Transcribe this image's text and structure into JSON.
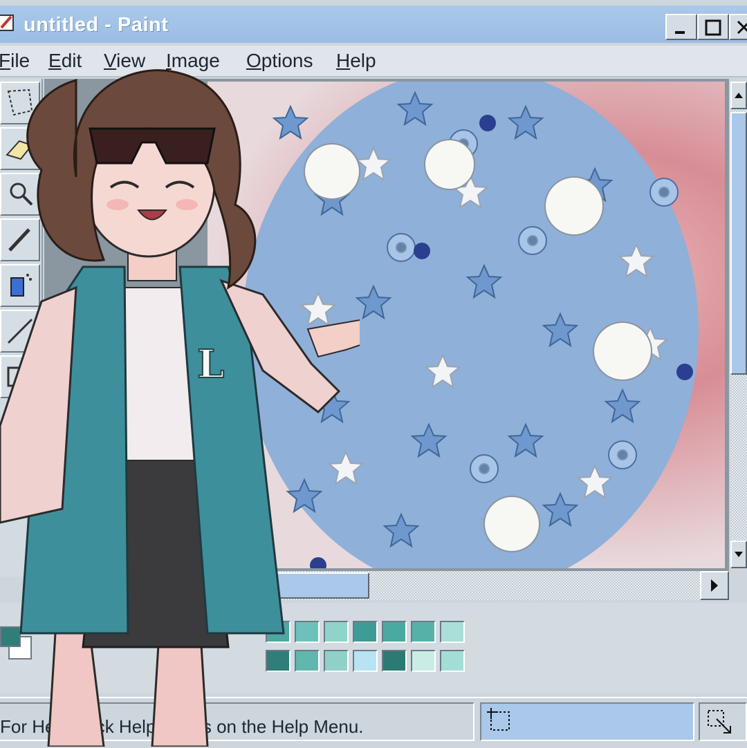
{
  "window": {
    "title": "untitled - Paint",
    "controls": [
      "minimize-button",
      "maximize-button",
      "close-button"
    ]
  },
  "menubar": {
    "items": [
      {
        "label": "File",
        "accel": "F",
        "rest": "ile"
      },
      {
        "label": "Edit",
        "accel": "E",
        "rest": "dit"
      },
      {
        "label": "View",
        "accel": "V",
        "rest": "iew"
      },
      {
        "label": "Image",
        "accel": "I",
        "rest": "mage"
      },
      {
        "label": "Options",
        "accel": "O",
        "rest": "ptions"
      },
      {
        "label": "Help",
        "accel": "H",
        "rest": "elp"
      }
    ]
  },
  "toolbox": {
    "tools": [
      "free-select-icon",
      "eraser-icon",
      "magnifier-icon",
      "pencil-icon",
      "airbrush-icon",
      "line-icon",
      "rectangle-icon"
    ]
  },
  "palette": {
    "colors_row1": [
      "#4fa6a2",
      "#6cc2bb",
      "#8fd3cb",
      "#3f9b95",
      "#4aa9a1",
      "#56b1a9",
      "#a9dfd8"
    ],
    "colors_row2": [
      "#2f7e78",
      "#5fb7ae",
      "#8fd0c8",
      "#b7e3f2",
      "#2b7a73",
      "#c9ece7",
      "#a4ddd6"
    ],
    "foreground": "#2f7e78",
    "background": "#ffffff"
  },
  "statusbar": {
    "help_text": "For Help, click Help Topics on the Help Menu."
  },
  "colors": {
    "title_bar": "#a9c8ea",
    "window_bg": "#cdd6dc",
    "accent_blue": "#a9c8ea"
  }
}
